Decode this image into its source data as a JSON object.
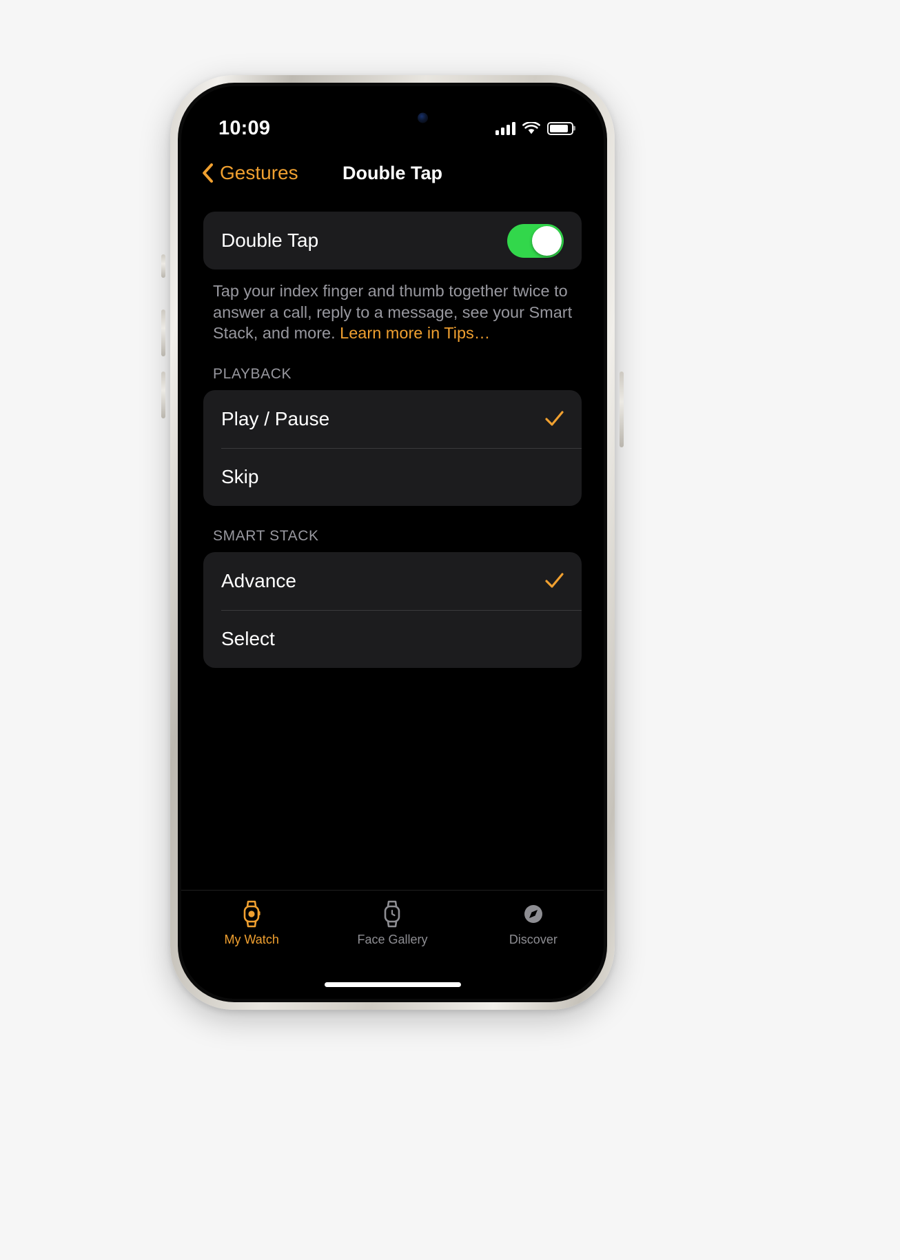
{
  "status_bar": {
    "time": "10:09",
    "cellular_icon": "cellular-signal-icon",
    "wifi_icon": "wifi-icon",
    "battery_icon": "battery-icon"
  },
  "nav": {
    "back_label": "Gestures",
    "title": "Double Tap"
  },
  "main": {
    "toggle_row": {
      "label": "Double Tap",
      "state": "on"
    },
    "description": {
      "text": "Tap your index finger and thumb together twice to answer a call, reply to a message, see your Smart Stack, and more. ",
      "link": "Learn more in Tips…"
    },
    "sections": [
      {
        "header": "PLAYBACK",
        "items": [
          {
            "label": "Play / Pause",
            "selected": true
          },
          {
            "label": "Skip",
            "selected": false
          }
        ]
      },
      {
        "header": "SMART STACK",
        "items": [
          {
            "label": "Advance",
            "selected": true
          },
          {
            "label": "Select",
            "selected": false
          }
        ]
      }
    ]
  },
  "tab_bar": {
    "tabs": [
      {
        "label": "My Watch",
        "icon": "watch-icon",
        "active": true
      },
      {
        "label": "Face Gallery",
        "icon": "watch-face-icon",
        "active": false
      },
      {
        "label": "Discover",
        "icon": "compass-icon",
        "active": false
      }
    ]
  },
  "colors": {
    "accent": "#f0a030",
    "toggle_on": "#32d74b",
    "card": "#1c1c1e",
    "secondary_text": "#98989f"
  }
}
